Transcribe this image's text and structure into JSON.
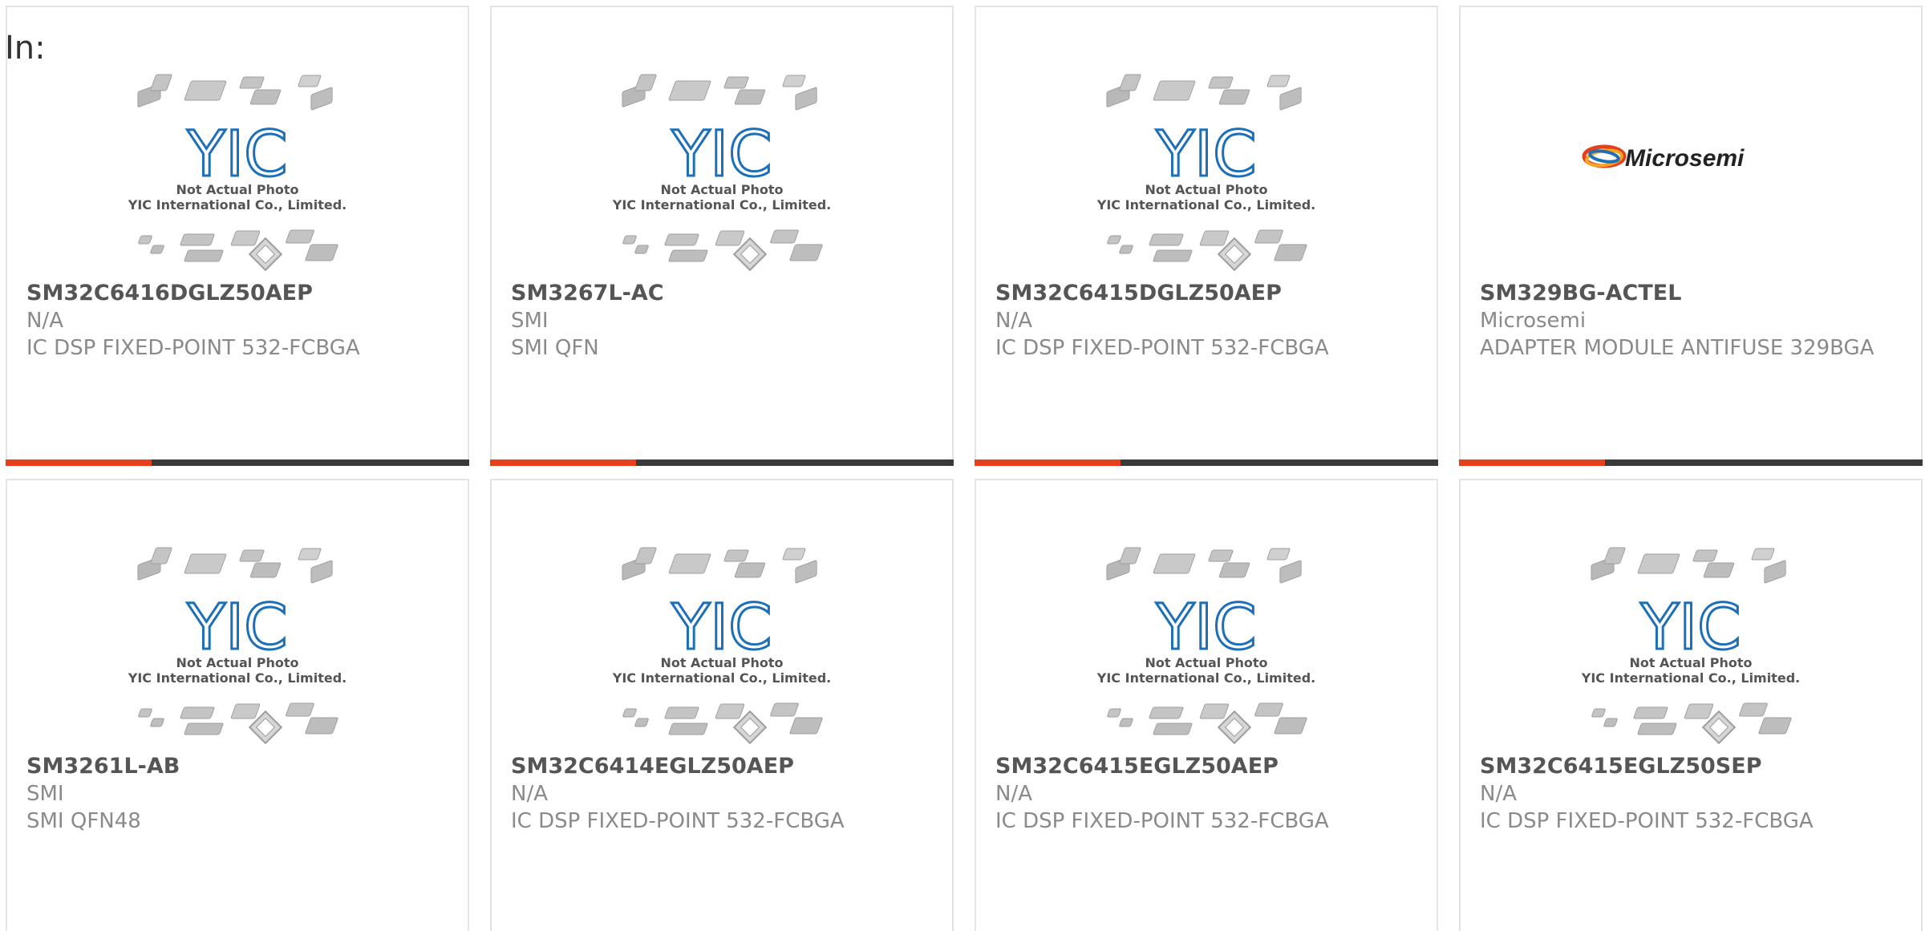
{
  "header": {
    "label": "In:"
  },
  "placeholder": {
    "line1": "Not Actual Photo",
    "line2": "YIC International Co., Limited.",
    "logo": "YIC"
  },
  "microsemi_logo": "Microsemi",
  "colors": {
    "accent": "#e8401c",
    "bar": "#3a3a3a",
    "logo_blue": "#1d6fb8"
  },
  "products": [
    {
      "part": "SM32C6416DGLZ50AEP",
      "mfr": "N/A",
      "desc": "IC DSP FIXED-POINT 532-FCBGA",
      "image": "yic-placeholder"
    },
    {
      "part": "SM3267L-AC",
      "mfr": "SMI",
      "desc": "SMI QFN",
      "image": "yic-placeholder"
    },
    {
      "part": "SM32C6415DGLZ50AEP",
      "mfr": "N/A",
      "desc": "IC DSP FIXED-POINT 532-FCBGA",
      "image": "yic-placeholder"
    },
    {
      "part": "SM329BG-ACTEL",
      "mfr": "Microsemi",
      "desc": "ADAPTER MODULE ANTIFUSE 329BGA",
      "image": "microsemi-logo"
    },
    {
      "part": "SM3261L-AB",
      "mfr": "SMI",
      "desc": "SMI QFN48",
      "image": "yic-placeholder"
    },
    {
      "part": "SM32C6414EGLZ50AEP",
      "mfr": "N/A",
      "desc": "IC DSP FIXED-POINT 532-FCBGA",
      "image": "yic-placeholder"
    },
    {
      "part": "SM32C6415EGLZ50AEP",
      "mfr": "N/A",
      "desc": "IC DSP FIXED-POINT 532-FCBGA",
      "image": "yic-placeholder"
    },
    {
      "part": "SM32C6415EGLZ50SEP",
      "mfr": "N/A",
      "desc": "IC DSP FIXED-POINT 532-FCBGA",
      "image": "yic-placeholder"
    }
  ]
}
